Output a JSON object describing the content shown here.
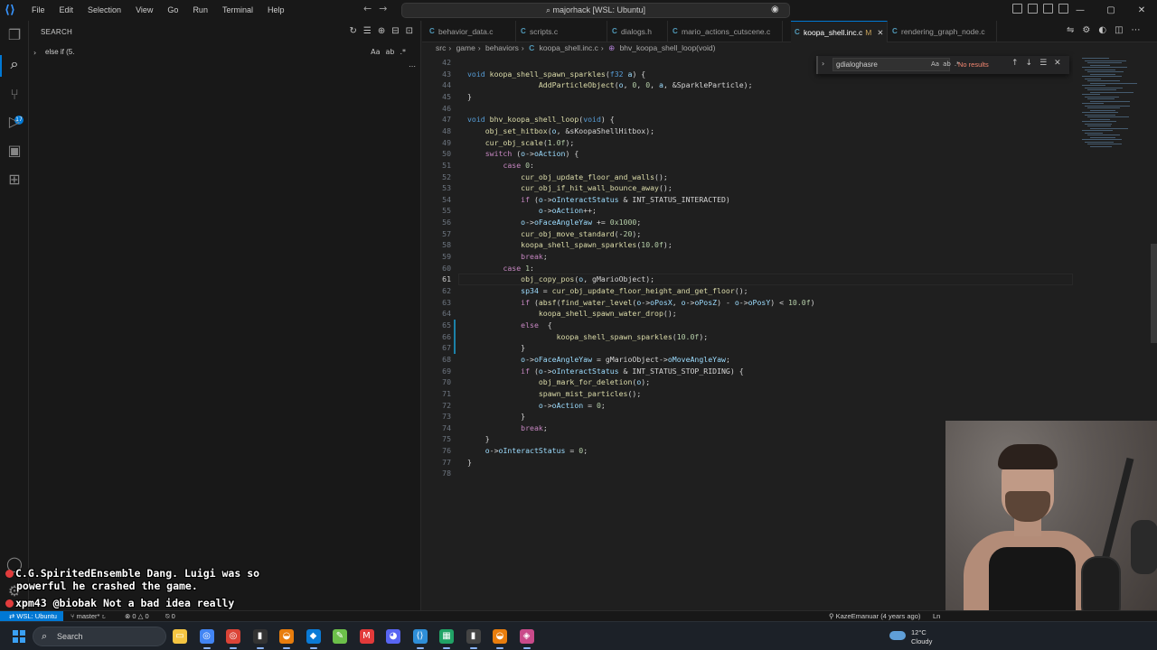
{
  "titlebar": {
    "menu": [
      "File",
      "Edit",
      "Selection",
      "View",
      "Go",
      "Run",
      "Terminal",
      "Help"
    ],
    "command_center": "majorhack [WSL: Ubuntu]"
  },
  "activity_bar": {
    "icons": [
      "explorer-icon",
      "search-icon",
      "source-control-icon",
      "run-debug-icon",
      "remote-explorer-icon",
      "extensions-icon",
      "account-icon",
      "settings-icon"
    ],
    "source_control_badge": "17"
  },
  "sidebar": {
    "title": "SEARCH",
    "search_value": "else if (5.",
    "options": [
      "Aa",
      "ab",
      ".*"
    ]
  },
  "chat": [
    {
      "user": "C.G.SpiritedEnsemble",
      "message": "Dang. Luigi was so",
      "continuation": "powerful he crashed the game."
    },
    {
      "user": "xpm43",
      "message": "@biobak Not a bad idea really"
    }
  ],
  "tabs": [
    {
      "label": "behavior_data.c",
      "active": false,
      "modified": false
    },
    {
      "label": "scripts.c",
      "active": false,
      "modified": false
    },
    {
      "label": "dialogs.h",
      "active": false,
      "modified": false
    },
    {
      "label": "mario_actions_cutscene.c",
      "active": false,
      "modified": false
    },
    {
      "label": "koopa_shell.inc.c",
      "active": true,
      "modified": true,
      "mod_marker": "M"
    },
    {
      "label": "rendering_graph_node.c",
      "active": false,
      "modified": false
    }
  ],
  "breadcrumb": [
    "src",
    "game",
    "behaviors",
    "koopa_shell.inc.c",
    "bhv_koopa_shell_loop(void)"
  ],
  "find_widget": {
    "query": "gdialoghasre",
    "options": [
      "Aa",
      "ab",
      ".*"
    ],
    "result": "No results"
  },
  "editor": {
    "current_line": "61",
    "lines": [
      {
        "n": "42",
        "indent": 0,
        "text": ""
      },
      {
        "n": "43",
        "indent": 0,
        "text": "void koopa_shell_spawn_sparkles(f32 a) {"
      },
      {
        "n": "44",
        "indent": 0,
        "text": "                AddParticleObject(o, 0, 0, a, &SparkleParticle);"
      },
      {
        "n": "45",
        "indent": 0,
        "text": "}"
      },
      {
        "n": "46",
        "indent": 0,
        "text": ""
      },
      {
        "n": "47",
        "indent": 0,
        "text": "void bhv_koopa_shell_loop(void) {"
      },
      {
        "n": "48",
        "indent": 0,
        "text": "    obj_set_hitbox(o, &sKoopaShellHitbox);"
      },
      {
        "n": "49",
        "indent": 0,
        "text": "    cur_obj_scale(1.0f);"
      },
      {
        "n": "50",
        "indent": 0,
        "text": "    switch (o->oAction) {"
      },
      {
        "n": "51",
        "indent": 0,
        "text": "        case 0:"
      },
      {
        "n": "52",
        "indent": 0,
        "text": "            cur_obj_update_floor_and_walls();"
      },
      {
        "n": "53",
        "indent": 0,
        "text": "            cur_obj_if_hit_wall_bounce_away();"
      },
      {
        "n": "54",
        "indent": 0,
        "text": "            if (o->oInteractStatus & INT_STATUS_INTERACTED)"
      },
      {
        "n": "55",
        "indent": 0,
        "text": "                o->oAction++;"
      },
      {
        "n": "56",
        "indent": 0,
        "text": "            o->oFaceAngleYaw += 0x1000;"
      },
      {
        "n": "57",
        "indent": 0,
        "text": "            cur_obj_move_standard(-20);"
      },
      {
        "n": "58",
        "indent": 0,
        "text": "            koopa_shell_spawn_sparkles(10.0f);"
      },
      {
        "n": "59",
        "indent": 0,
        "text": "            break;"
      },
      {
        "n": "60",
        "indent": 0,
        "text": "        case 1:"
      },
      {
        "n": "61",
        "indent": 0,
        "text": "            obj_copy_pos(o, gMarioObject);"
      },
      {
        "n": "62",
        "indent": 0,
        "text": "            sp34 = cur_obj_update_floor_height_and_get_floor();"
      },
      {
        "n": "63",
        "indent": 0,
        "text": "            if (absf(find_water_level(o->oPosX, o->oPosZ) - o->oPosY) < 10.0f)"
      },
      {
        "n": "64",
        "indent": 0,
        "text": "                koopa_shell_spawn_water_drop();"
      },
      {
        "n": "65",
        "indent": 0,
        "text": "            else  {"
      },
      {
        "n": "66",
        "indent": 0,
        "text": "                    koopa_shell_spawn_sparkles(10.0f);"
      },
      {
        "n": "67",
        "indent": 0,
        "text": "            }"
      },
      {
        "n": "68",
        "indent": 0,
        "text": "            o->oFaceAngleYaw = gMarioObject->oMoveAngleYaw;"
      },
      {
        "n": "69",
        "indent": 0,
        "text": "            if (o->oInteractStatus & INT_STATUS_STOP_RIDING) {"
      },
      {
        "n": "70",
        "indent": 0,
        "text": "                obj_mark_for_deletion(o);"
      },
      {
        "n": "71",
        "indent": 0,
        "text": "                spawn_mist_particles();"
      },
      {
        "n": "72",
        "indent": 0,
        "text": "                o->oAction = 0;"
      },
      {
        "n": "73",
        "indent": 0,
        "text": "            }"
      },
      {
        "n": "74",
        "indent": 0,
        "text": "            break;"
      },
      {
        "n": "75",
        "indent": 0,
        "text": "    }"
      },
      {
        "n": "76",
        "indent": 0,
        "text": "    o->oInteractStatus = 0;"
      },
      {
        "n": "77",
        "indent": 0,
        "text": "}"
      },
      {
        "n": "78",
        "indent": 0,
        "text": ""
      }
    ]
  },
  "statusbar": {
    "remote": "WSL: Ubuntu",
    "branch": "master*",
    "errors": "0",
    "warnings": "0",
    "ports": "0",
    "blame": "KazeEmanuar (4 years ago)",
    "position": "Ln"
  },
  "taskbar": {
    "search_placeholder": "Search",
    "apps": [
      "file-explorer",
      "chrome",
      "chrome-2",
      "terminal",
      "blender",
      "vs",
      "notepad-plus",
      "mario",
      "discord",
      "vscode",
      "excel-like",
      "terminal-2",
      "blender-2",
      "game"
    ],
    "weather_temp": "12°C",
    "weather_desc": "Cloudy"
  },
  "colors": {
    "accent": "#0078d4",
    "editor_bg": "#1f1f1f",
    "no_results": "#f48771"
  }
}
